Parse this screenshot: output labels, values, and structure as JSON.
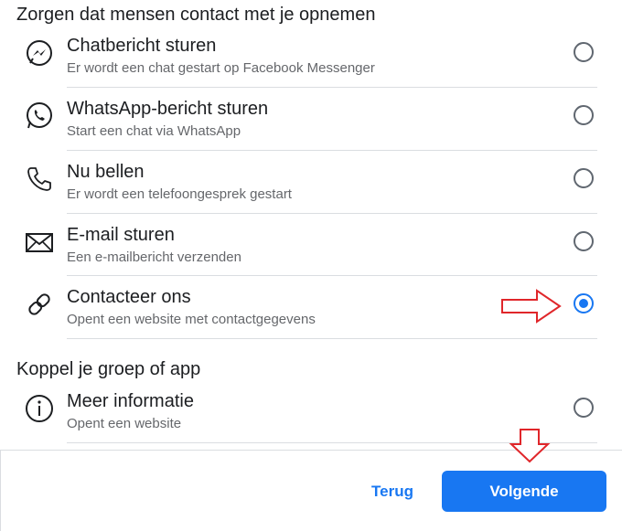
{
  "sections": {
    "contact_title": "Zorgen dat mensen contact met je opnemen",
    "connect_title": "Koppel je groep of app"
  },
  "options": [
    {
      "icon": "messenger-icon",
      "title": "Chatbericht sturen",
      "subtitle": "Er wordt een chat gestart op Facebook Messenger",
      "selected": false
    },
    {
      "icon": "whatsapp-icon",
      "title": "WhatsApp-bericht sturen",
      "subtitle": "Start een chat via WhatsApp",
      "selected": false
    },
    {
      "icon": "phone-icon",
      "title": "Nu bellen",
      "subtitle": "Er wordt een telefoongesprek gestart",
      "selected": false
    },
    {
      "icon": "envelope-icon",
      "title": "E-mail sturen",
      "subtitle": "Een e-mailbericht verzenden",
      "selected": false
    },
    {
      "icon": "link-icon",
      "title": "Contacteer ons",
      "subtitle": "Opent een website met contactgegevens",
      "selected": true
    },
    {
      "icon": "info-icon",
      "title": "Meer informatie",
      "subtitle": "Opent een website",
      "selected": false
    }
  ],
  "footer": {
    "back_label": "Terug",
    "next_label": "Volgende"
  },
  "colors": {
    "accent": "#1877f2",
    "annotation_arrow": "#e0262a"
  }
}
